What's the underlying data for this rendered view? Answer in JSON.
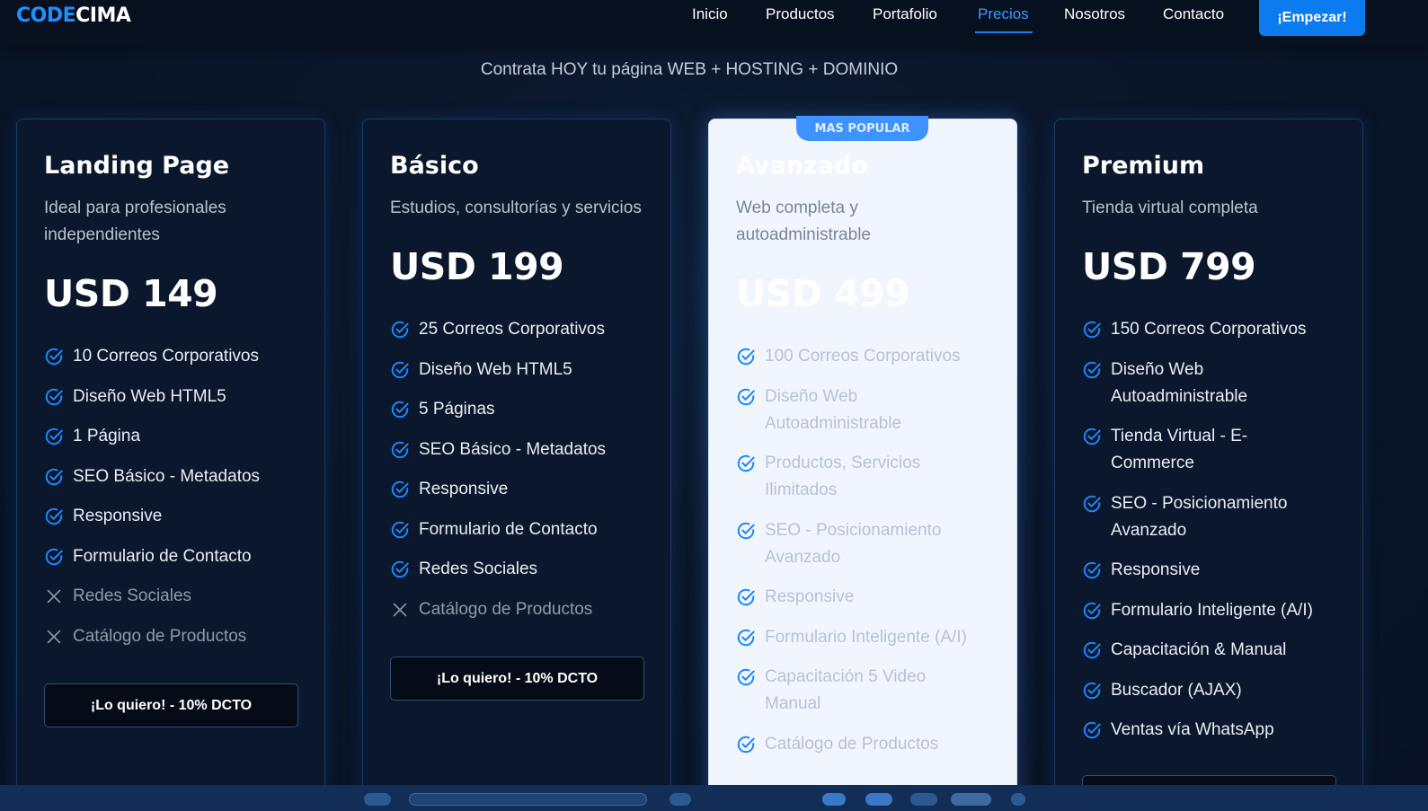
{
  "navbar": {
    "logo": {
      "part1": "CODE",
      "part2": "CIMA"
    },
    "links": [
      {
        "label": "Inicio",
        "active": false
      },
      {
        "label": "Productos",
        "active": false
      },
      {
        "label": "Portafolio",
        "active": false
      },
      {
        "label": "Precios",
        "active": true
      },
      {
        "label": "Nosotros",
        "active": false
      },
      {
        "label": "Contacto",
        "active": false
      }
    ],
    "cta": "¡Empezar!"
  },
  "subtitle": "Contrata HOY tu página WEB + HOSTING + DOMINIO",
  "plans": [
    {
      "title": "Landing Page",
      "description": "Ideal para profesionales independientes",
      "price": "USD 149",
      "features": [
        {
          "text": "10 Correos Corporativos",
          "included": true
        },
        {
          "text": "Diseño Web HTML5",
          "included": true
        },
        {
          "text": "1 Página",
          "included": true
        },
        {
          "text": "SEO Básico - Metadatos",
          "included": true
        },
        {
          "text": "Responsive",
          "included": true
        },
        {
          "text": "Formulario de Contacto",
          "included": true
        },
        {
          "text": "Redes Sociales",
          "included": false
        },
        {
          "text": "Catálogo de Productos",
          "included": false
        }
      ],
      "button": "¡Lo quiero! - 10% DCTO"
    },
    {
      "title": "Básico",
      "description": "Estudios, consultorías y servicios",
      "price": "USD 199",
      "features": [
        {
          "text": "25 Correos Corporativos",
          "included": true
        },
        {
          "text": "Diseño Web HTML5",
          "included": true
        },
        {
          "text": "5 Páginas",
          "included": true
        },
        {
          "text": "SEO Básico - Metadatos",
          "included": true
        },
        {
          "text": "Responsive",
          "included": true
        },
        {
          "text": "Formulario de Contacto",
          "included": true
        },
        {
          "text": "Redes Sociales",
          "included": true
        },
        {
          "text": "Catálogo de Productos",
          "included": false
        }
      ],
      "button": "¡Lo quiero! - 10% DCTO"
    },
    {
      "badge": "MAS POPULAR",
      "title": "Avanzado",
      "description": "Web completa y autoadministrable",
      "price": "USD 499",
      "features": [
        {
          "text": "100 Correos Corporativos",
          "included": true
        },
        {
          "text": "Diseño Web Autoadministrable",
          "included": true
        },
        {
          "text": "Productos, Servicios Ilimitados",
          "included": true
        },
        {
          "text": "SEO - Posicionamiento Avanzado",
          "included": true
        },
        {
          "text": "Responsive",
          "included": true
        },
        {
          "text": "Formulario Inteligente (A/I)",
          "included": true
        },
        {
          "text": "Capacitación 5 Video Manual",
          "included": true
        },
        {
          "text": "Catálogo de Productos",
          "included": true
        }
      ]
    },
    {
      "title": "Premium",
      "description": "Tienda virtual completa",
      "price": "USD 799",
      "features": [
        {
          "text": "150 Correos Corporativos",
          "included": true
        },
        {
          "text": "Diseño Web Autoadministrable",
          "included": true
        },
        {
          "text": "Tienda Virtual - E-Commerce",
          "included": true
        },
        {
          "text": "SEO - Posicionamiento Avanzado",
          "included": true
        },
        {
          "text": "Responsive",
          "included": true
        },
        {
          "text": "Formulario Inteligente (A/I)",
          "included": true
        },
        {
          "text": "Capacitación & Manual",
          "included": true
        },
        {
          "text": "Buscador (AJAX)",
          "included": true
        },
        {
          "text": "Ventas vía WhatsApp",
          "included": true
        }
      ]
    }
  ],
  "icons": {
    "included": "check-circle-icon",
    "excluded": "x-icon"
  },
  "colors": {
    "accent": "#1e90ff",
    "background": "#0a1426",
    "featured_card": "#f1f6fe",
    "taskbar": "#122e57"
  }
}
